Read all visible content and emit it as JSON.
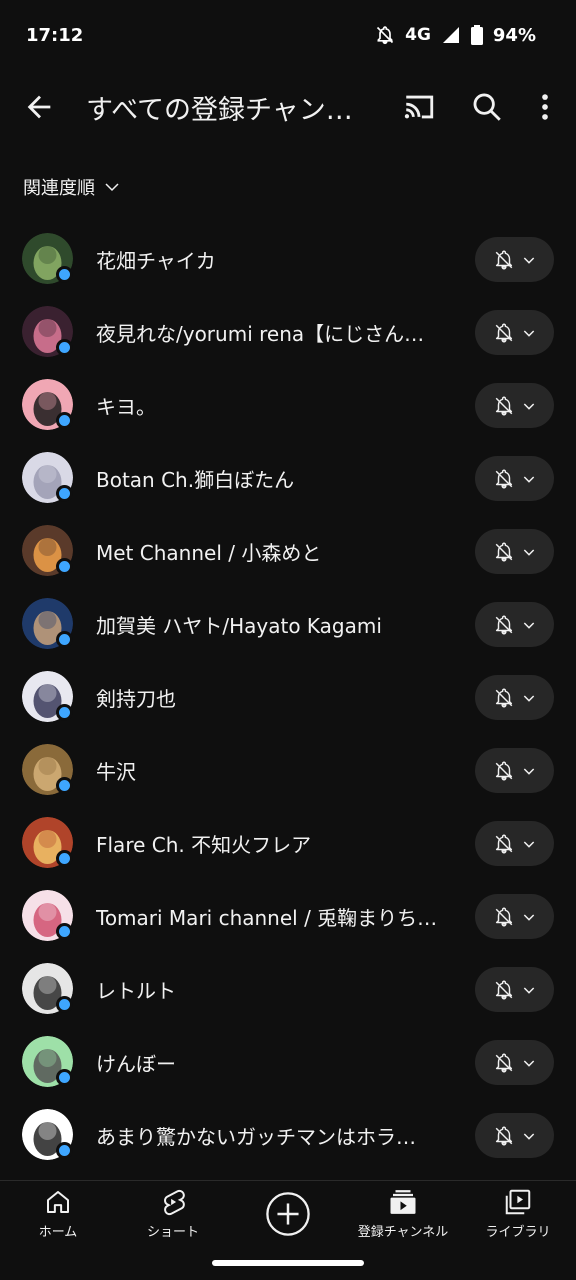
{
  "status_bar": {
    "time": "17:12",
    "network": "4G",
    "battery": "94%"
  },
  "header": {
    "title": "すべての登録チャン…"
  },
  "sort": {
    "label": "関連度順"
  },
  "channels": [
    {
      "name": "花畑チャイカ",
      "avatar_colors": [
        "#2f4a2c",
        "#8fb46a"
      ]
    },
    {
      "name": "夜見れな/yorumi rena【にじさん…",
      "avatar_colors": [
        "#3a2130",
        "#e07a9a"
      ]
    },
    {
      "name": "キヨ。",
      "avatar_colors": [
        "#f0a7b4",
        "#1a1a1a"
      ]
    },
    {
      "name": "Botan Ch.獅白ぼたん",
      "avatar_colors": [
        "#d9d9e6",
        "#9a9ab0"
      ]
    },
    {
      "name": "Met Channel / 小森めと",
      "avatar_colors": [
        "#5a3a2a",
        "#f2a24a"
      ]
    },
    {
      "name": "加賀美 ハヤト/Hayato Kagami",
      "avatar_colors": [
        "#1f3a6a",
        "#c9a27a"
      ]
    },
    {
      "name": "剣持刀也",
      "avatar_colors": [
        "#e8e8f0",
        "#3a3a5a"
      ]
    },
    {
      "name": "牛沢",
      "avatar_colors": [
        "#8a6a3a",
        "#d6b27a"
      ]
    },
    {
      "name": "Flare Ch. 不知火フレア",
      "avatar_colors": [
        "#b0442a",
        "#f2c46a"
      ]
    },
    {
      "name": "Tomari Mari channel / 兎鞠まりち…",
      "avatar_colors": [
        "#f6e0e8",
        "#d0506e"
      ]
    },
    {
      "name": "レトルト",
      "avatar_colors": [
        "#e6e6e6",
        "#2a2a2a"
      ]
    },
    {
      "name": "けんぼー",
      "avatar_colors": [
        "#9ee0a8",
        "#555555"
      ]
    },
    {
      "name": "あまり驚かないガッチマンはホラ…",
      "avatar_colors": [
        "#ffffff",
        "#222222"
      ]
    }
  ],
  "bottom_nav": {
    "home": "ホーム",
    "shorts": "ショート",
    "subscriptions": "登録チャンネル",
    "library": "ライブラリ"
  },
  "colors": {
    "background": "#0f0f0f",
    "pill": "#272727",
    "badge": "#3ea6ff"
  }
}
